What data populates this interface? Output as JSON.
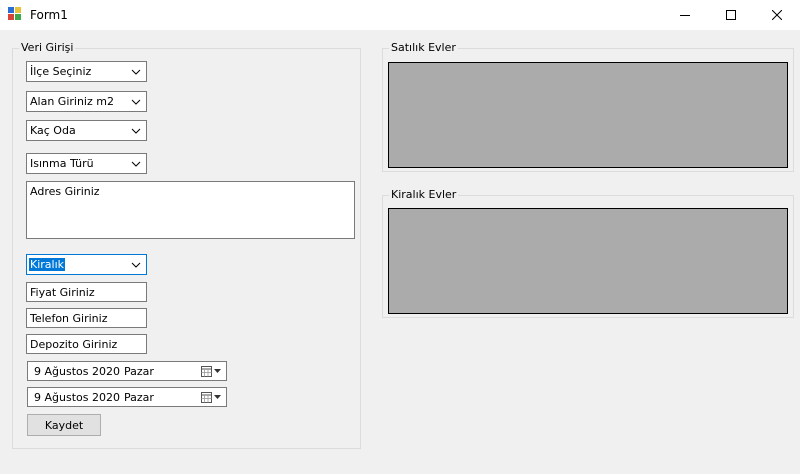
{
  "window": {
    "title": "Form1"
  },
  "input_group": {
    "title": "Veri Girişi",
    "district_combo": "İlçe Seçiniz",
    "area_combo": "Alan Giriniz m2",
    "rooms_combo": "Kaç Oda",
    "heating_combo": "Isınma Türü",
    "address_placeholder": "Adres Giriniz",
    "type_combo": "Kiralık",
    "price_field": "Fiyat Giriniz",
    "phone_field": "Telefon Giriniz",
    "deposit_field": "Depozito Giriniz",
    "date1": {
      "day": "9 Ağustos 2020",
      "weekday": "Pazar"
    },
    "date2": {
      "day": "9 Ağustos 2020",
      "weekday": "Pazar"
    },
    "save_button": "Kaydet"
  },
  "sale_group": {
    "title": "Satılık Evler"
  },
  "rent_group": {
    "title": "Kiralık Evler"
  },
  "colors": {
    "grid_background": "#ababab",
    "selection": "#0078d7",
    "window_background": "#f0f0f0"
  }
}
